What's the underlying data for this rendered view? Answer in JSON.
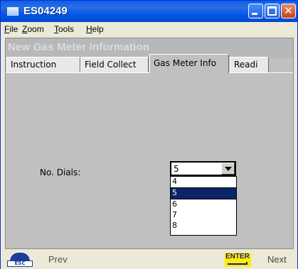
{
  "window": {
    "title": "ES04249"
  },
  "menu": {
    "items": [
      "File",
      "Zoom",
      "Tools",
      "Help"
    ]
  },
  "form": {
    "title": "New Gas Meter Information",
    "tabs": [
      "Instruction",
      "Field Collect",
      "Gas Meter Info",
      "Readi"
    ],
    "active_tab": "Gas Meter Info",
    "fields": {
      "dials": {
        "label": "No. Dials:",
        "value": "5",
        "options": [
          "4",
          "5",
          "6",
          "7",
          "8"
        ],
        "highlighted_option": "5"
      }
    }
  },
  "bottom": {
    "esc_label": "ESC",
    "prev_label": "Prev",
    "enter_label": "ENTER",
    "next_label": "Next"
  },
  "colors": {
    "titlebar": "#0054e3",
    "form_bg": "#c0c0c0",
    "selection": "#0a246a",
    "enter_key": "#ffee00"
  }
}
